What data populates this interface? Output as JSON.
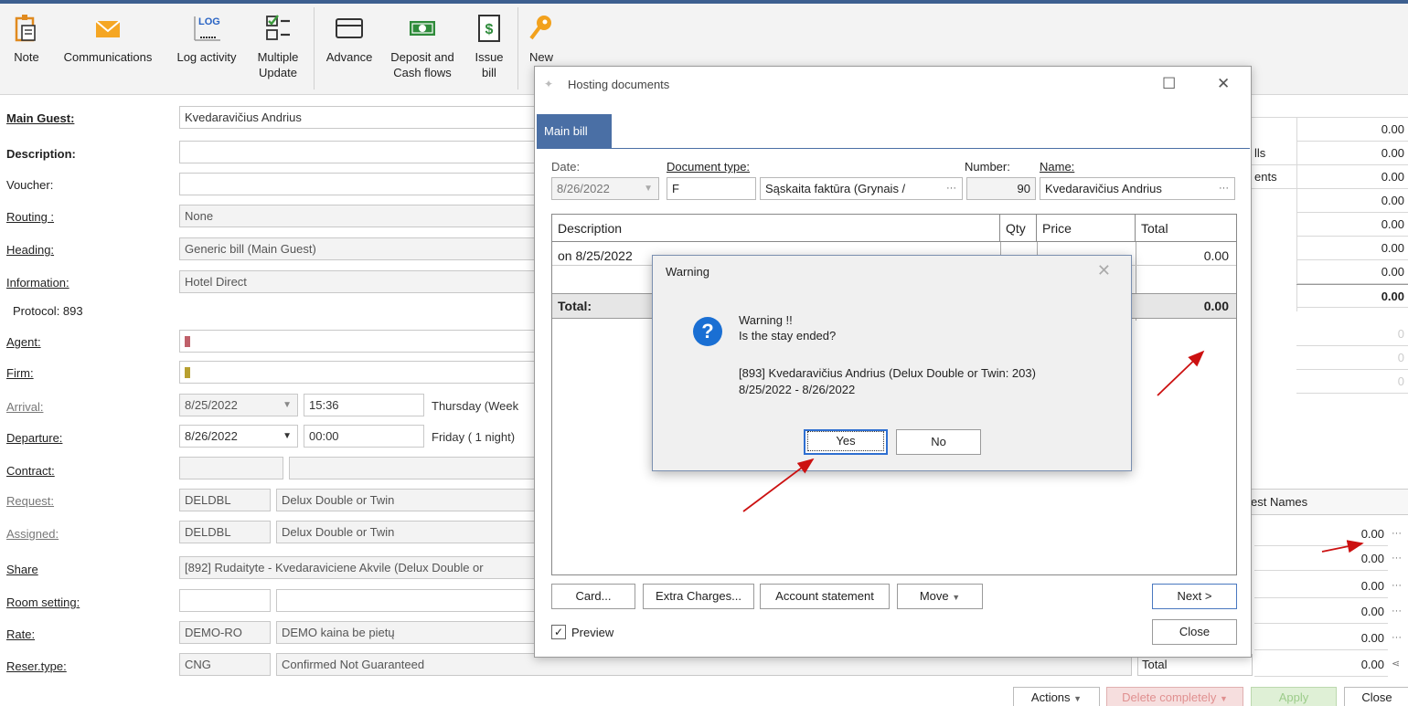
{
  "ribbon": {
    "buttons": [
      {
        "label": "Note",
        "icon": "clipboard-icon"
      },
      {
        "label": "Communications",
        "icon": "envelope-icon"
      },
      {
        "label": "Log activity",
        "icon": "log-icon",
        "icon_text": "LOG"
      },
      {
        "label": "Multiple Update",
        "icon": "checklist-icon"
      },
      {
        "label": "Advance",
        "icon": "advance-icon"
      },
      {
        "label": "Deposit and Cash flows",
        "icon": "cash-icon"
      },
      {
        "label": "Issue bill",
        "icon": "bill-icon"
      },
      {
        "label": "New",
        "icon": "key-icon"
      }
    ]
  },
  "form": {
    "main_guest_label": "Main Guest:",
    "main_guest": "Kvedaravičius Andrius",
    "description_label": "Description:",
    "voucher_label": "Voucher:",
    "routing_label": "Routing :",
    "routing": "None",
    "heading_label": "Heading:",
    "heading": "Generic bill (Main Guest)",
    "information_label": "Information:",
    "information": "Hotel Direct",
    "protocol": "Protocol: 893",
    "agent_label": "Agent:",
    "firm_label": "Firm:",
    "arrival_label": "Arrival:",
    "arrival_date": "8/25/2022",
    "arrival_time": "15:36",
    "arrival_day": "Thursday (Week",
    "departure_label": "Departure:",
    "departure_date": "8/26/2022",
    "departure_time": "00:00",
    "departure_day": "Friday ( 1 night)",
    "contract_label": "Contract:",
    "request_label": "Request:",
    "request_code": "DELDBL",
    "request_name": "Delux Double or Twin",
    "assigned_label": "Assigned:",
    "assigned_code": "DELDBL",
    "assigned_name": "Delux Double or Twin",
    "share_label": "Share",
    "share": "[892] Rudaityte - Kvedaraviciene Akvile (Delux Double or",
    "room_setting_label": "Room setting:",
    "rate_label": "Rate:",
    "rate_code": "DEMO-RO",
    "rate_name": "DEMO kaina be pietų",
    "reser_type_label": "Reser.type:",
    "reser_type_code": "CNG",
    "reser_type_name": "Confirmed Not Guaranteed"
  },
  "right_panel": {
    "labels": [
      "lls",
      "ents"
    ],
    "values_top": [
      "0.00",
      "0.00",
      "0.00",
      "0.00",
      "0.00",
      "0.00",
      "0.00",
      "0.00"
    ],
    "faded_values": [
      "0",
      "0",
      "0"
    ],
    "guest_names_header": "est Names",
    "values_bottom": [
      "0.00",
      "0.00",
      "0.00",
      "0.00",
      "0.00"
    ],
    "total_label": "Total",
    "total_value": "0.00"
  },
  "bottom_bar": {
    "actions": "Actions",
    "delete": "Delete completely",
    "apply": "Apply",
    "close": "Close"
  },
  "hosting": {
    "title": "Hosting documents",
    "tab": "Main bill",
    "date_label": "Date:",
    "date": "8/26/2022",
    "doc_type_label": "Document type:",
    "doc_code": "F",
    "doc_name": "Sąskaita faktūra (Grynais /",
    "number_label": "Number:",
    "number": "90",
    "name_label": "Name:",
    "name": "Kvedaravičius Andrius",
    "columns": [
      "Description",
      "Qty",
      "Price",
      "Total"
    ],
    "row_desc": "on 8/25/2022",
    "row_total": "0.00",
    "total_label": "Total:",
    "total_value": "0.00",
    "buttons": {
      "card": "Card...",
      "extra": "Extra Charges...",
      "statement": "Account statement",
      "move": "Move",
      "next": "Next >",
      "close": "Close"
    },
    "preview": "Preview"
  },
  "warning": {
    "title": "Warning",
    "line1": "Warning !!",
    "line2": "Is the stay ended?",
    "line3": "[893] Kvedaravičius Andrius (Delux Double or Twin: 203)",
    "line4": "8/25/2022 - 8/26/2022",
    "yes": "Yes",
    "no": "No"
  },
  "colors": {
    "accent": "#4a6fa5",
    "annotation_arrow": "#cc1111",
    "agent_swatch": "#c0606a",
    "firm_swatch": "#b8a030"
  }
}
